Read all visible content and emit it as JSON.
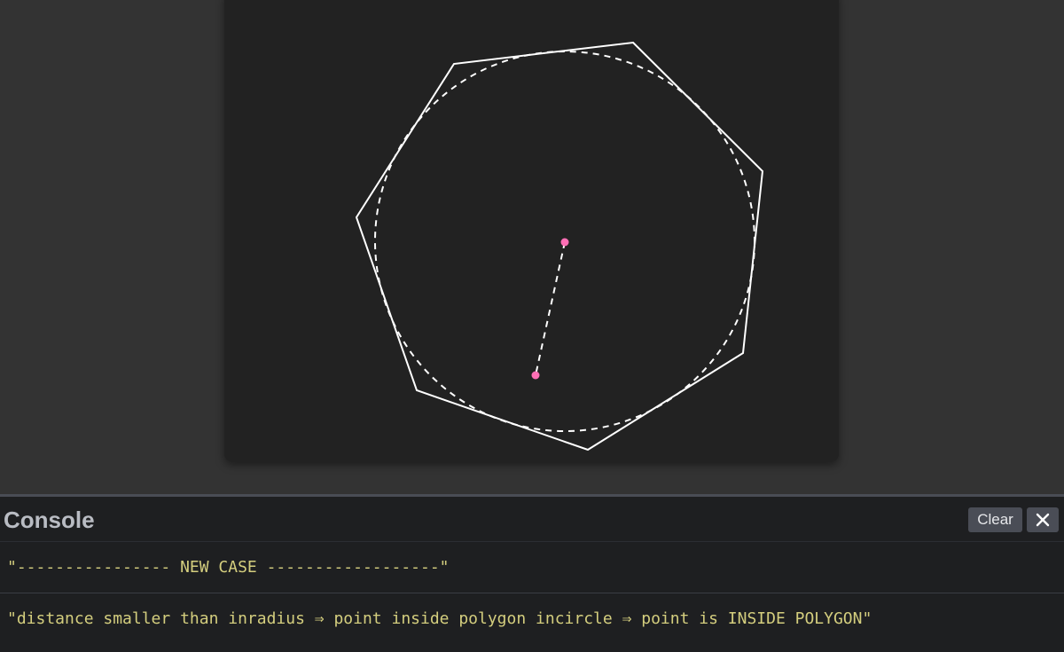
{
  "colors": {
    "background": "#333333",
    "canvas": "#222222",
    "stroke": "#ffffff",
    "point": "#ff6fb5",
    "console_bg": "#1e1f21",
    "console_text": "#d4ce7e"
  },
  "console": {
    "title": "Console",
    "clear_label": "Clear",
    "close_icon": "close-icon",
    "logs": [
      "\"---------------- NEW CASE ------------------\"",
      "\"distance smaller than inradius ⇒ point inside polygon incircle ⇒ point is INSIDE POLYGON\""
    ]
  }
}
